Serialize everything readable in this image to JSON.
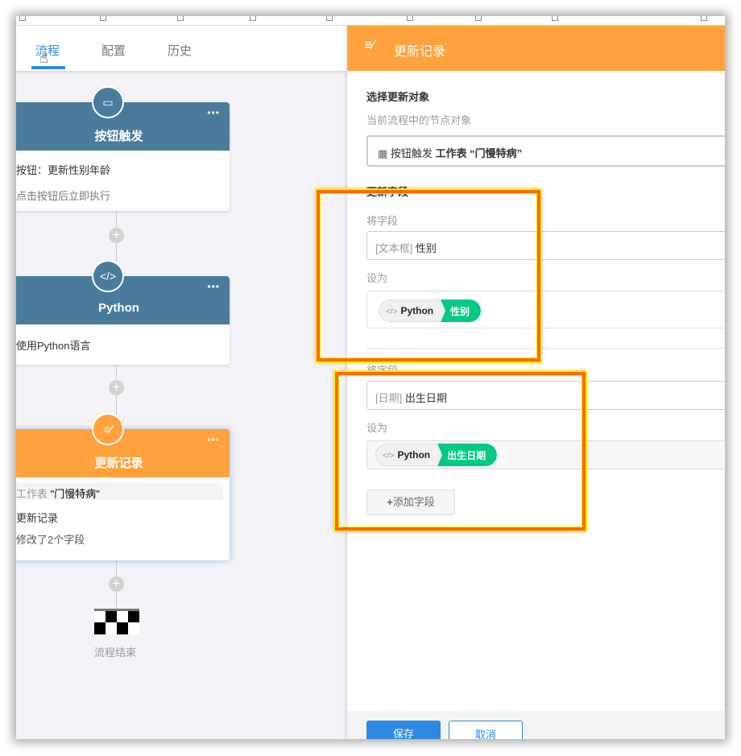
{
  "tabs": [
    {
      "label": "流程"
    },
    {
      "label": "配置"
    },
    {
      "label": "历史"
    }
  ],
  "flow": {
    "nodes": [
      {
        "title": "按钮触发",
        "lines": [
          "按钮：更新性别年龄",
          "点击按钮后立即执行"
        ]
      },
      {
        "title": "Python",
        "lines": [
          "使用Python语言"
        ]
      },
      {
        "title": "更新记录",
        "sheet_label": "工作表",
        "sheet_name": "\"门慢特病\"",
        "lines": [
          "更新记录",
          "修改了2个字段"
        ]
      }
    ],
    "end_label": "流程结束"
  },
  "panel": {
    "title": "更新记录",
    "select_title": "选择更新对象",
    "select_hint": "当前流程中的节点对象",
    "target_node": "按钮触发",
    "target_sheet": "工作表 “门慢特病”",
    "update_fields_title": "更新字段",
    "fields": [
      {
        "label": "将字段",
        "type": "[文本框]",
        "name": "性别",
        "set_label": "设为",
        "source": "Python",
        "value": "性别"
      },
      {
        "label": "将字段",
        "type": "[日期]",
        "name": "出生日期",
        "set_label": "设为",
        "source": "Python",
        "value": "出生日期"
      }
    ],
    "add_field": "添加字段",
    "save": "保存",
    "cancel": "取消"
  },
  "colors": {
    "accent": "#2d8ae0",
    "node_blue": "#4a7b9d",
    "node_orange": "#ffa23e",
    "pill_green": "#01ca83",
    "highlight": "#ff6a00"
  }
}
